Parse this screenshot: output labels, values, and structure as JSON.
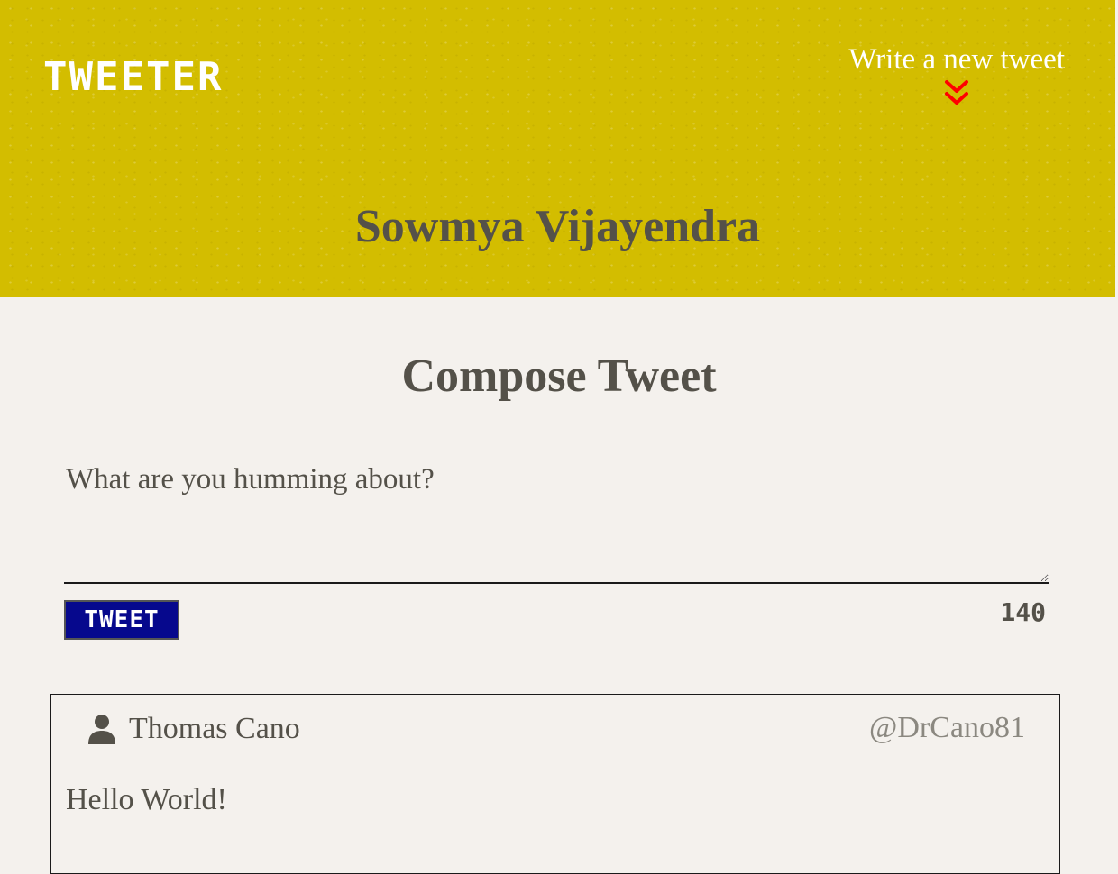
{
  "header": {
    "logo_text": "TWEETER",
    "nav_write_label": "Write a new tweet",
    "nav_icon": "double-chevron-down-icon",
    "profile_name": "Sowmya Vijayendra",
    "background_color": "#d3bd00",
    "accent_icon_color": "#ff0000"
  },
  "compose": {
    "title": "Compose Tweet",
    "placeholder": "What are you humming about?",
    "value": "",
    "submit_label": "TWEET",
    "char_counter": "140",
    "submit_color": "#06088d"
  },
  "tweets": [
    {
      "author": "Thomas Cano",
      "handle": "@DrCano81",
      "content": "Hello World!",
      "avatar_icon": "user-icon"
    }
  ]
}
